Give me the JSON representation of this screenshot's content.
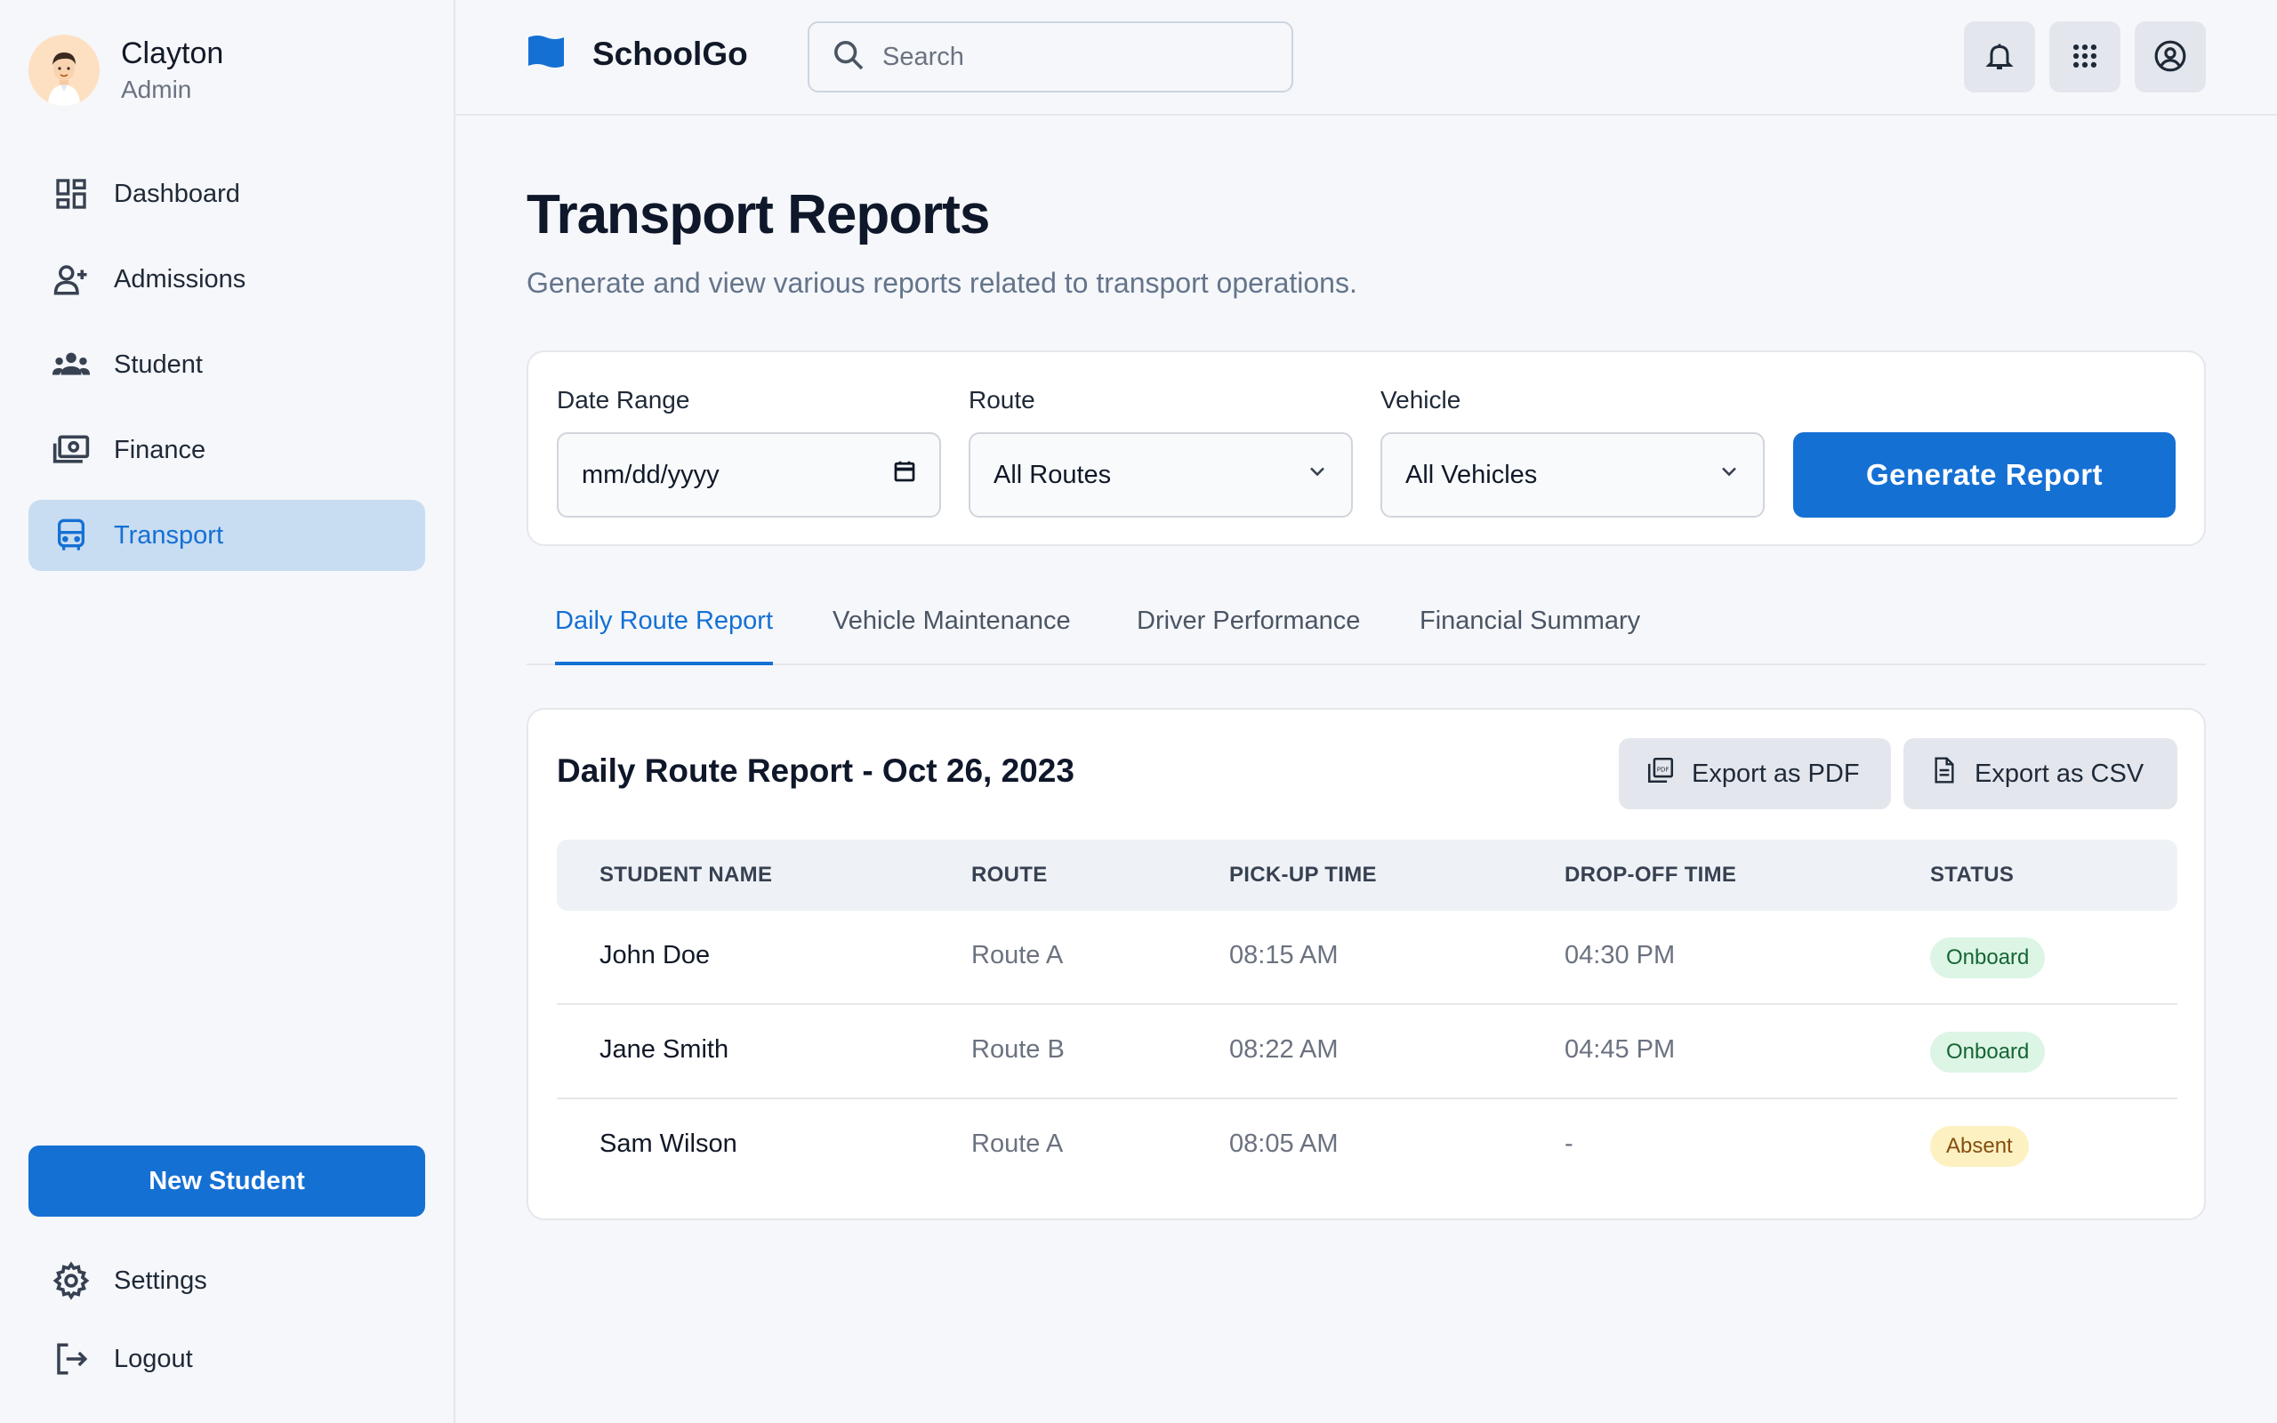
{
  "profile": {
    "name": "Clayton",
    "role": "Admin"
  },
  "sidebar": {
    "items": [
      {
        "label": "Dashboard",
        "icon": "dashboard-icon"
      },
      {
        "label": "Admissions",
        "icon": "person-add-icon"
      },
      {
        "label": "Student",
        "icon": "group-icon"
      },
      {
        "label": "Finance",
        "icon": "money-icon"
      },
      {
        "label": "Transport",
        "icon": "bus-icon",
        "active": true
      }
    ],
    "new_student_label": "New Student",
    "settings_label": "Settings",
    "logout_label": "Logout"
  },
  "header": {
    "brand": "SchoolGo",
    "search_placeholder": "Search",
    "icons": [
      "bell-icon",
      "apps-grid-icon",
      "account-circle-icon"
    ]
  },
  "page": {
    "title": "Transport Reports",
    "subtitle": "Generate and view various reports related to transport operations."
  },
  "filters": {
    "date_label": "Date Range",
    "date_value": "mm/dd/yyyy",
    "route_label": "Route",
    "route_value": "All Routes",
    "vehicle_label": "Vehicle",
    "vehicle_value": "All Vehicles",
    "generate_label": "Generate Report"
  },
  "tabs": [
    {
      "label": "Daily Route Report",
      "active": true
    },
    {
      "label": "Vehicle Maintenance"
    },
    {
      "label": "Driver Performance"
    },
    {
      "label": "Financial Summary"
    }
  ],
  "report": {
    "title": "Daily Route Report - Oct 26, 2023",
    "export_pdf": "Export as PDF",
    "export_csv": "Export as CSV",
    "columns": [
      "STUDENT NAME",
      "ROUTE",
      "PICK-UP TIME",
      "DROP-OFF TIME",
      "STATUS"
    ],
    "rows": [
      {
        "name": "John Doe",
        "route": "Route A",
        "pickup": "08:15 AM",
        "dropoff": "04:30 PM",
        "status": "Onboard"
      },
      {
        "name": "Jane Smith",
        "route": "Route B",
        "pickup": "08:22 AM",
        "dropoff": "04:45 PM",
        "status": "Onboard"
      },
      {
        "name": "Sam Wilson",
        "route": "Route A",
        "pickup": "08:05 AM",
        "dropoff": "-",
        "status": "Absent"
      }
    ]
  },
  "colors": {
    "accent": "#1570d4",
    "active_bg": "#c9ddf2",
    "onboard_bg": "#dcf5e5",
    "absent_bg": "#fdf1c2"
  }
}
